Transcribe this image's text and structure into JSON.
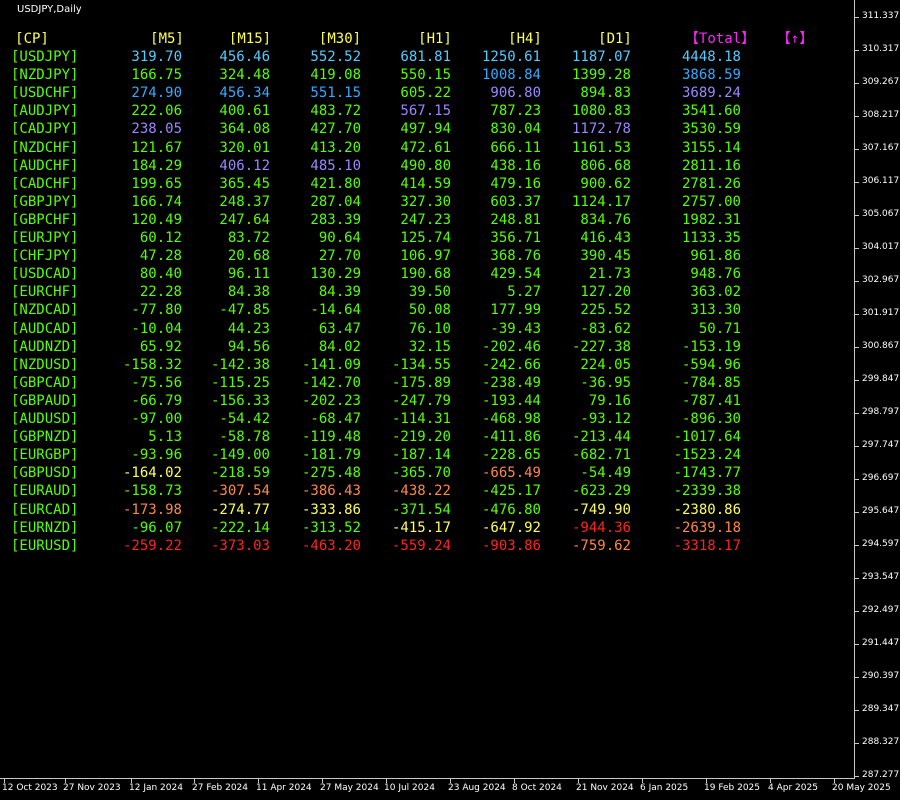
{
  "chart": {
    "title": "USDJPY,Daily"
  },
  "price_axis": [
    "311.337",
    "310.317",
    "309.267",
    "308.217",
    "307.167",
    "306.117",
    "305.067",
    "304.017",
    "302.967",
    "301.917",
    "300.867",
    "299.847",
    "298.797",
    "297.747",
    "296.697",
    "295.647",
    "294.597",
    "293.547",
    "292.497",
    "291.447",
    "290.397",
    "289.347",
    "288.327",
    "287.277"
  ],
  "time_axis": [
    "12 Oct 2023",
    "27 Nov 2023",
    "12 Jan 2024",
    "27 Feb 2024",
    "11 Apr 2024",
    "27 May 2024",
    "10 Jul 2024",
    "23 Aug 2024",
    "8 Oct 2024",
    "21 Nov 2024",
    "6 Jan 2025",
    "19 Feb 2025",
    "4 Apr 2025",
    "20 May 2025"
  ],
  "colors": {
    "green": "#55ff00",
    "yellow": "#ffff55",
    "orange": "#ff8844",
    "red": "#ff2222",
    "blue": "#33aaff",
    "lightblue": "#55ccff",
    "purple": "#9988ff",
    "magenta": "#ff22ff",
    "white": "#ffffff"
  },
  "table": {
    "headers": [
      "[CP]",
      "[M5]",
      "[M15]",
      "[M30]",
      "[H1]",
      "[H4]",
      "[D1]",
      "【Total】",
      "【↑】"
    ],
    "header_colors": [
      "yellow",
      "yellow",
      "yellow",
      "yellow",
      "yellow",
      "yellow",
      "yellow",
      "magenta",
      "magenta"
    ],
    "rows": [
      {
        "pair": "[USDJPY]",
        "m5": "319.70",
        "m15": "456.46",
        "m30": "552.52",
        "h1": "681.81",
        "h4": "1250.61",
        "d1": "1187.07",
        "total": "4448.18",
        "colors": [
          "lightblue",
          "lightblue",
          "lightblue",
          "lightblue",
          "lightblue",
          "lightblue",
          "lightblue"
        ]
      },
      {
        "pair": "[NZDJPY]",
        "m5": "166.75",
        "m15": "324.48",
        "m30": "419.08",
        "h1": "550.15",
        "h4": "1008.84",
        "d1": "1399.28",
        "total": "3868.59",
        "colors": [
          "green",
          "green",
          "green",
          "green",
          "blue",
          "green",
          "blue"
        ]
      },
      {
        "pair": "[USDCHF]",
        "m5": "274.90",
        "m15": "456.34",
        "m30": "551.15",
        "h1": "605.22",
        "h4": "906.80",
        "d1": "894.83",
        "total": "3689.24",
        "colors": [
          "blue",
          "blue",
          "blue",
          "green",
          "purple",
          "green",
          "purple"
        ]
      },
      {
        "pair": "[AUDJPY]",
        "m5": "222.06",
        "m15": "400.61",
        "m30": "483.72",
        "h1": "567.15",
        "h4": "787.23",
        "d1": "1080.83",
        "total": "3541.60",
        "colors": [
          "green",
          "green",
          "green",
          "purple",
          "green",
          "green",
          "green"
        ]
      },
      {
        "pair": "[CADJPY]",
        "m5": "238.05",
        "m15": "364.08",
        "m30": "427.70",
        "h1": "497.94",
        "h4": "830.04",
        "d1": "1172.78",
        "total": "3530.59",
        "colors": [
          "purple",
          "green",
          "green",
          "green",
          "green",
          "purple",
          "green"
        ]
      },
      {
        "pair": "[NZDCHF]",
        "m5": "121.67",
        "m15": "320.01",
        "m30": "413.20",
        "h1": "472.61",
        "h4": "666.11",
        "d1": "1161.53",
        "total": "3155.14",
        "colors": [
          "green",
          "green",
          "green",
          "green",
          "green",
          "green",
          "green"
        ]
      },
      {
        "pair": "[AUDCHF]",
        "m5": "184.29",
        "m15": "406.12",
        "m30": "485.10",
        "h1": "490.80",
        "h4": "438.16",
        "d1": "806.68",
        "total": "2811.16",
        "colors": [
          "green",
          "purple",
          "purple",
          "green",
          "green",
          "green",
          "green"
        ]
      },
      {
        "pair": "[CADCHF]",
        "m5": "199.65",
        "m15": "365.45",
        "m30": "421.80",
        "h1": "414.59",
        "h4": "479.16",
        "d1": "900.62",
        "total": "2781.26",
        "colors": [
          "green",
          "green",
          "green",
          "green",
          "green",
          "green",
          "green"
        ]
      },
      {
        "pair": "[GBPJPY]",
        "m5": "166.74",
        "m15": "248.37",
        "m30": "287.04",
        "h1": "327.30",
        "h4": "603.37",
        "d1": "1124.17",
        "total": "2757.00",
        "colors": [
          "green",
          "green",
          "green",
          "green",
          "green",
          "green",
          "green"
        ]
      },
      {
        "pair": "[GBPCHF]",
        "m5": "120.49",
        "m15": "247.64",
        "m30": "283.39",
        "h1": "247.23",
        "h4": "248.81",
        "d1": "834.76",
        "total": "1982.31",
        "colors": [
          "green",
          "green",
          "green",
          "green",
          "green",
          "green",
          "green"
        ]
      },
      {
        "pair": "[EURJPY]",
        "m5": "60.12",
        "m15": "83.72",
        "m30": "90.64",
        "h1": "125.74",
        "h4": "356.71",
        "d1": "416.43",
        "total": "1133.35",
        "colors": [
          "green",
          "green",
          "green",
          "green",
          "green",
          "green",
          "green"
        ]
      },
      {
        "pair": "[CHFJPY]",
        "m5": "47.28",
        "m15": "20.68",
        "m30": "27.70",
        "h1": "106.97",
        "h4": "368.76",
        "d1": "390.45",
        "total": "961.86",
        "colors": [
          "green",
          "green",
          "green",
          "green",
          "green",
          "green",
          "green"
        ]
      },
      {
        "pair": "[USDCAD]",
        "m5": "80.40",
        "m15": "96.11",
        "m30": "130.29",
        "h1": "190.68",
        "h4": "429.54",
        "d1": "21.73",
        "total": "948.76",
        "colors": [
          "green",
          "green",
          "green",
          "green",
          "green",
          "green",
          "green"
        ]
      },
      {
        "pair": "[EURCHF]",
        "m5": "22.28",
        "m15": "84.38",
        "m30": "84.39",
        "h1": "39.50",
        "h4": "5.27",
        "d1": "127.20",
        "total": "363.02",
        "colors": [
          "green",
          "green",
          "green",
          "green",
          "green",
          "green",
          "green"
        ]
      },
      {
        "pair": "[NZDCAD]",
        "m5": "-77.80",
        "m15": "-47.85",
        "m30": "-14.64",
        "h1": "50.08",
        "h4": "177.99",
        "d1": "225.52",
        "total": "313.30",
        "colors": [
          "green",
          "green",
          "green",
          "green",
          "green",
          "green",
          "green"
        ]
      },
      {
        "pair": "[AUDCAD]",
        "m5": "-10.04",
        "m15": "44.23",
        "m30": "63.47",
        "h1": "76.10",
        "h4": "-39.43",
        "d1": "-83.62",
        "total": "50.71",
        "colors": [
          "green",
          "green",
          "green",
          "green",
          "green",
          "green",
          "green"
        ]
      },
      {
        "pair": "[AUDNZD]",
        "m5": "65.92",
        "m15": "94.56",
        "m30": "84.02",
        "h1": "32.15",
        "h4": "-202.46",
        "d1": "-227.38",
        "total": "-153.19",
        "colors": [
          "green",
          "green",
          "green",
          "green",
          "green",
          "green",
          "green"
        ]
      },
      {
        "pair": "[NZDUSD]",
        "m5": "-158.32",
        "m15": "-142.38",
        "m30": "-141.09",
        "h1": "-134.55",
        "h4": "-242.66",
        "d1": "224.05",
        "total": "-594.96",
        "colors": [
          "green",
          "green",
          "green",
          "green",
          "green",
          "green",
          "green"
        ]
      },
      {
        "pair": "[GBPCAD]",
        "m5": "-75.56",
        "m15": "-115.25",
        "m30": "-142.70",
        "h1": "-175.89",
        "h4": "-238.49",
        "d1": "-36.95",
        "total": "-784.85",
        "colors": [
          "green",
          "green",
          "green",
          "green",
          "green",
          "green",
          "green"
        ]
      },
      {
        "pair": "[GBPAUD]",
        "m5": "-66.79",
        "m15": "-156.33",
        "m30": "-202.23",
        "h1": "-247.79",
        "h4": "-193.44",
        "d1": "79.16",
        "total": "-787.41",
        "colors": [
          "green",
          "green",
          "green",
          "green",
          "green",
          "green",
          "green"
        ]
      },
      {
        "pair": "[AUDUSD]",
        "m5": "-97.00",
        "m15": "-54.42",
        "m30": "-68.47",
        "h1": "-114.31",
        "h4": "-468.98",
        "d1": "-93.12",
        "total": "-896.30",
        "colors": [
          "green",
          "green",
          "green",
          "green",
          "green",
          "green",
          "green"
        ]
      },
      {
        "pair": "[GBPNZD]",
        "m5": "5.13",
        "m15": "-58.78",
        "m30": "-119.48",
        "h1": "-219.20",
        "h4": "-411.86",
        "d1": "-213.44",
        "total": "-1017.64",
        "colors": [
          "green",
          "green",
          "green",
          "green",
          "green",
          "green",
          "green"
        ]
      },
      {
        "pair": "[EURGBP]",
        "m5": "-93.96",
        "m15": "-149.00",
        "m30": "-181.79",
        "h1": "-187.14",
        "h4": "-228.65",
        "d1": "-682.71",
        "total": "-1523.24",
        "colors": [
          "green",
          "green",
          "green",
          "green",
          "green",
          "green",
          "green"
        ]
      },
      {
        "pair": "[GBPUSD]",
        "m5": "-164.02",
        "m15": "-218.59",
        "m30": "-275.48",
        "h1": "-365.70",
        "h4": "-665.49",
        "d1": "-54.49",
        "total": "-1743.77",
        "colors": [
          "yellow",
          "green",
          "green",
          "green",
          "orange",
          "green",
          "green"
        ]
      },
      {
        "pair": "[EURAUD]",
        "m5": "-158.73",
        "m15": "-307.54",
        "m30": "-386.43",
        "h1": "-438.22",
        "h4": "-425.17",
        "d1": "-623.29",
        "total": "-2339.38",
        "colors": [
          "green",
          "orange",
          "orange",
          "orange",
          "green",
          "green",
          "green"
        ]
      },
      {
        "pair": "[EURCAD]",
        "m5": "-173.98",
        "m15": "-274.77",
        "m30": "-333.86",
        "h1": "-371.54",
        "h4": "-476.80",
        "d1": "-749.90",
        "total": "-2380.86",
        "colors": [
          "orange",
          "yellow",
          "yellow",
          "green",
          "green",
          "yellow",
          "yellow"
        ]
      },
      {
        "pair": "[EURNZD]",
        "m5": "-96.07",
        "m15": "-222.14",
        "m30": "-313.52",
        "h1": "-415.17",
        "h4": "-647.92",
        "d1": "-944.36",
        "total": "-2639.18",
        "colors": [
          "green",
          "green",
          "green",
          "yellow",
          "yellow",
          "red",
          "orange"
        ]
      },
      {
        "pair": "[EURUSD]",
        "m5": "-259.22",
        "m15": "-373.03",
        "m30": "-463.20",
        "h1": "-559.24",
        "h4": "-903.86",
        "d1": "-759.62",
        "total": "-3318.17",
        "colors": [
          "red",
          "red",
          "red",
          "red",
          "red",
          "orange",
          "red"
        ]
      }
    ]
  }
}
